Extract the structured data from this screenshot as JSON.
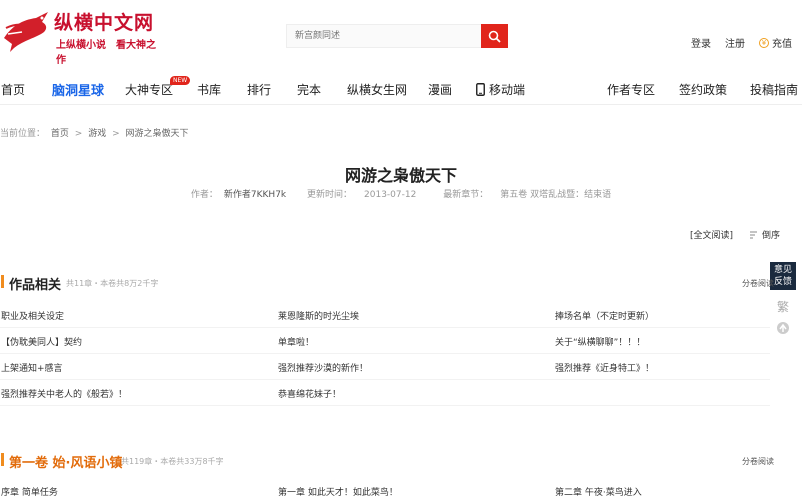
{
  "header": {
    "brand": "纵横中文网",
    "slogan": "上纵横小说　看大神之作",
    "search_placeholder": "新宫颜同述",
    "login": "登录",
    "register": "注册",
    "recharge": "充值"
  },
  "nav": {
    "items": [
      "首页",
      "脑洞星球",
      "大神专区",
      "书库",
      "排行",
      "完本",
      "纵横女生网",
      "漫画",
      "移动端",
      "作者专区",
      "签约政策",
      "投稿指南"
    ],
    "badge": "NEW"
  },
  "breadcrumb": {
    "prefix": "当前位置：",
    "home": "首页",
    "category": "游戏",
    "book": "网游之枭傲天下"
  },
  "book": {
    "title": "网游之枭傲天下",
    "author_label": "作者：",
    "author": "新作者7KKH7k",
    "update_label": "更新时间：",
    "update_time": "2013-07-12",
    "latest_label": "最新章节：",
    "latest_chapter": "第五卷 双塔乱战暨：结束语"
  },
  "view_ops": {
    "full_read": "[全文阅读]",
    "reverse": "倒序"
  },
  "side": {
    "feedback": [
      "意见",
      "反馈"
    ],
    "fan": "繁"
  },
  "sections": [
    {
      "title": "作品相关",
      "count": "共11章・本卷共8万2千字",
      "order": "分卷阅读",
      "rows": [
        [
          "职业及相关设定",
          "莱恩隆斯的时光尘埃",
          "捧场名单（不定时更新）"
        ],
        [
          "【伪耽美同人】契约",
          "单章啦！",
          "关于“纵横聊聊”！！！"
        ],
        [
          "上架通知+感言",
          "强烈推荐沙漠的新作！",
          "强烈推荐《近身特工》！"
        ],
        [
          "强烈推荐关中老人的《般若》！",
          "恭喜绵花妹子！",
          ""
        ]
      ]
    },
    {
      "title": "第一卷 始·风语小镇",
      "count": "共119章・本卷共33万8千字",
      "order": "分卷阅读",
      "rows": [
        [
          "序章 简单任务",
          "第一章 如此天才！如此菜鸟！",
          "第二章 午夜·菜鸟进入"
        ]
      ]
    }
  ]
}
